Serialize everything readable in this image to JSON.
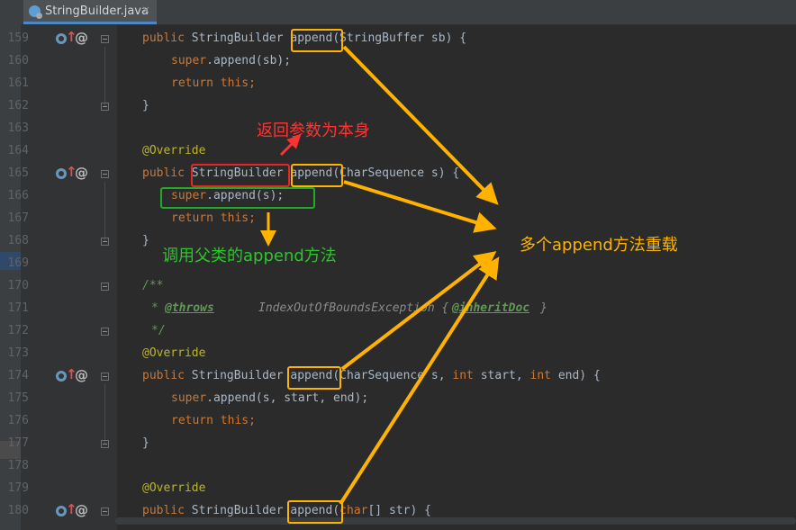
{
  "editor": {
    "tab": {
      "label": "StringBuilder.java",
      "close": "×",
      "icon": "java-class-icon"
    }
  },
  "lines": [
    {
      "num": "159"
    },
    {
      "num": "160"
    },
    {
      "num": "161"
    },
    {
      "num": "162"
    },
    {
      "num": "163"
    },
    {
      "num": "164"
    },
    {
      "num": "165"
    },
    {
      "num": "166"
    },
    {
      "num": "167"
    },
    {
      "num": "168"
    },
    {
      "num": "169"
    },
    {
      "num": "170"
    },
    {
      "num": "171"
    },
    {
      "num": "172"
    },
    {
      "num": "173"
    },
    {
      "num": "174"
    },
    {
      "num": "175"
    },
    {
      "num": "176"
    },
    {
      "num": "177"
    },
    {
      "num": "178"
    },
    {
      "num": "179"
    },
    {
      "num": "180"
    }
  ],
  "tokens": {
    "public": "public",
    "sb_type": "StringBuilder",
    "append": "append",
    "l159_params": "(StringBuffer sb) {",
    "super": "super",
    "l160_rest": ".append(sb);",
    "return": "return",
    "this": "this",
    "semi": ";",
    "close_brace": "}",
    "override": "@Override",
    "l165_params": "(CharSequence s) {",
    "l166_rest": ".append(s);",
    "javadoc_open": "/**",
    "javadoc_star": "*",
    "throws_tag": "@throws",
    "throws_text": "IndexOutOfBoundsException {",
    "inherit_tag": "@inheritDoc",
    "inherit_close": "}",
    "javadoc_close": "*/",
    "l174_params_a": "(CharSequence s, ",
    "int": "int",
    "l174_start": " start, ",
    "l174_end": " end) {",
    "l175_rest": ".append(s, start, end);",
    "l180_open": "(",
    "char": "char",
    "l180_rest": "[] str) {"
  },
  "annotations": {
    "return_self": "返回参数为本身",
    "call_parent": "调用父类的append方法",
    "overloads": "多个append方法重载"
  },
  "colors": {
    "background": "#2b2b2b",
    "keyword": "#cc7832",
    "annotation": "#bbb529",
    "javadoc": "#629755",
    "arrow_orange": "#ffb300",
    "box_red": "#e8262a",
    "box_green": "#23a929",
    "note_red": "#ff3333",
    "note_green": "#2cc52c",
    "note_orange": "#ffb300"
  }
}
